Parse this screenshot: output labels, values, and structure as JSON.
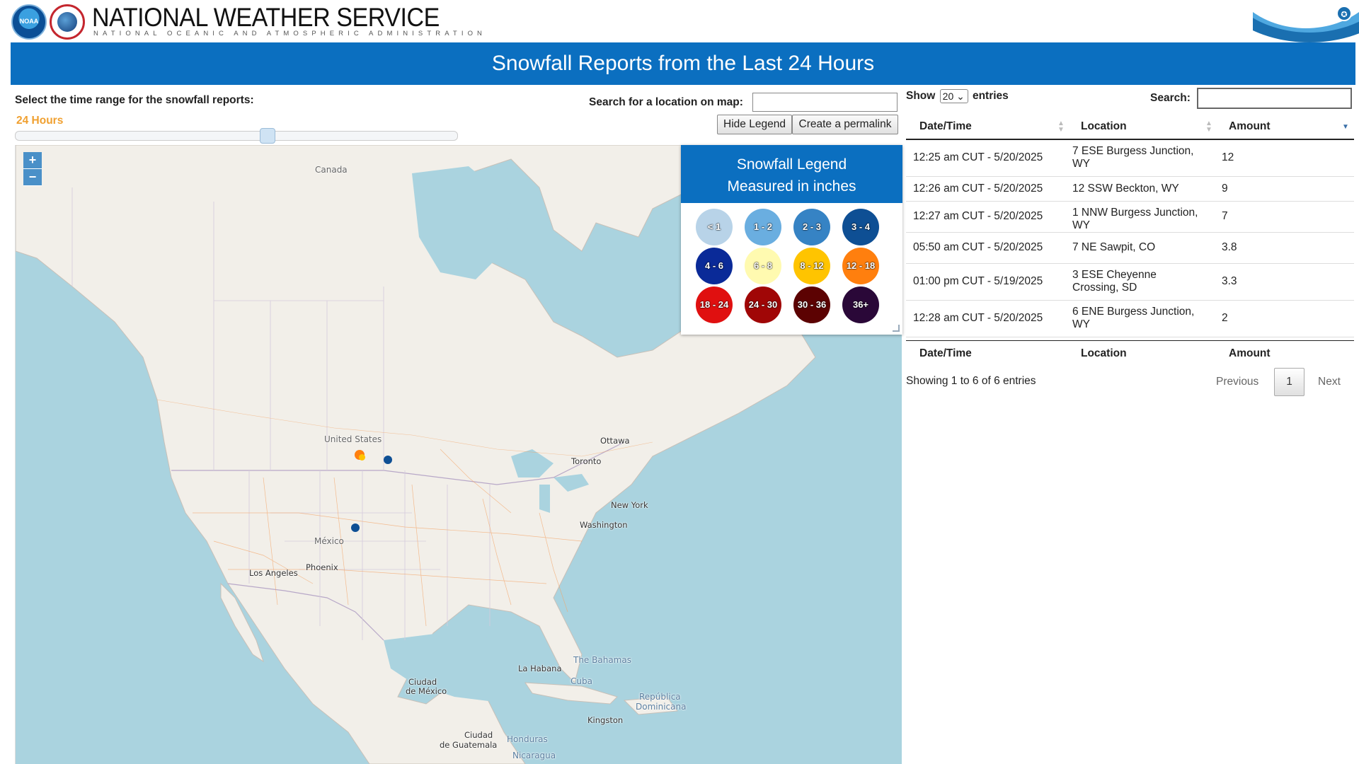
{
  "header": {
    "agency_title": "NATIONAL WEATHER SERVICE",
    "agency_subtitle": "NATIONAL OCEANIC AND ATMOSPHERIC ADMINISTRATION",
    "noaa_logo_text": "NOAA",
    "noaa_logo_icon": "noaa-logo",
    "nws_logo_icon": "nws-logo",
    "dept_icon": "commerce-seal-icon"
  },
  "banner": {
    "title": "Snowfall Reports from the Last 24 Hours"
  },
  "controls": {
    "time_range_label": "Select the time range for the snowfall reports:",
    "time_range_value": "24 Hours",
    "slider_position": 0.57,
    "search_map_label": "Search for a location on map:",
    "search_map_value": "",
    "hide_legend_label": "Hide Legend",
    "permalink_label": "Create a permalink"
  },
  "map": {
    "zoom_in": "+",
    "zoom_out": "−",
    "labels": {
      "canada": "Canada",
      "united_states": "United States",
      "mexico": "México",
      "ottawa": "Ottawa",
      "toronto": "Toronto",
      "new_york": "New York",
      "washington": "Washington",
      "los_angeles": "Los Angeles",
      "phoenix": "Phoenix",
      "la_habana": "La Habana",
      "the_bahamas": "The Bahamas",
      "cuba": "Cuba",
      "republica_dominicana_1": "República",
      "republica_dominicana_2": "Dominicana",
      "kingston": "Kingston",
      "ciudad_mexico_1": "Ciudad",
      "ciudad_mexico_2": "de México",
      "ciudad_guatemala_1": "Ciudad",
      "ciudad_guatemala_2": "de Guatemala",
      "honduras": "Honduras",
      "nicaragua": "Nicaragua"
    },
    "colors": {
      "water": "#aad3df",
      "land": "#f2efe9"
    }
  },
  "legend": {
    "title_line1": "Snowfall Legend",
    "title_line2": "Measured in inches",
    "items": [
      {
        "label": "< 1",
        "color": "#b8d3e8"
      },
      {
        "label": "1 - 2",
        "color": "#6aaee0"
      },
      {
        "label": "2 - 3",
        "color": "#3683c4"
      },
      {
        "label": "3 - 4",
        "color": "#0e4f94"
      },
      {
        "label": "4 - 6",
        "color": "#0a2a98"
      },
      {
        "label": "6 - 8",
        "color": "#fffab0"
      },
      {
        "label": "8 - 12",
        "color": "#ffc400"
      },
      {
        "label": "12 - 18",
        "color": "#ff7f0e"
      },
      {
        "label": "18 - 24",
        "color": "#e01010"
      },
      {
        "label": "24 - 30",
        "color": "#a00606"
      },
      {
        "label": "30 - 36",
        "color": "#5c0202"
      },
      {
        "label": "36+",
        "color": "#2a0838"
      }
    ]
  },
  "table": {
    "show_label": "Show",
    "show_value": "20",
    "entries_label": "entries",
    "search_label": "Search:",
    "search_value": "",
    "columns": [
      "Date/Time",
      "Location",
      "Amount"
    ],
    "rows": [
      {
        "datetime": "12:25 am CUT - 5/20/2025",
        "location_1": "7 ESE Burgess Junction,",
        "location_2": "WY",
        "amount": "12"
      },
      {
        "datetime": "12:26 am CUT - 5/20/2025",
        "location_1": "12 SSW Beckton, WY",
        "location_2": "",
        "amount": "9"
      },
      {
        "datetime": "12:27 am CUT - 5/20/2025",
        "location_1": "1 NNW Burgess Junction,",
        "location_2": "WY",
        "amount": "7"
      },
      {
        "datetime": "05:50 am CUT - 5/20/2025",
        "location_1": "7 NE Sawpit, CO",
        "location_2": "",
        "amount": "3.8"
      },
      {
        "datetime": "01:00 pm CUT - 5/19/2025",
        "location_1": "3 ESE Cheyenne",
        "location_2": "Crossing, SD",
        "amount": "3.3"
      },
      {
        "datetime": "12:28 am CUT - 5/20/2025",
        "location_1": "6 ENE Burgess Junction,",
        "location_2": "WY",
        "amount": "2"
      }
    ],
    "info": "Showing 1 to 6 of 6 entries",
    "previous_label": "Previous",
    "current_page": "1",
    "next_label": "Next"
  }
}
